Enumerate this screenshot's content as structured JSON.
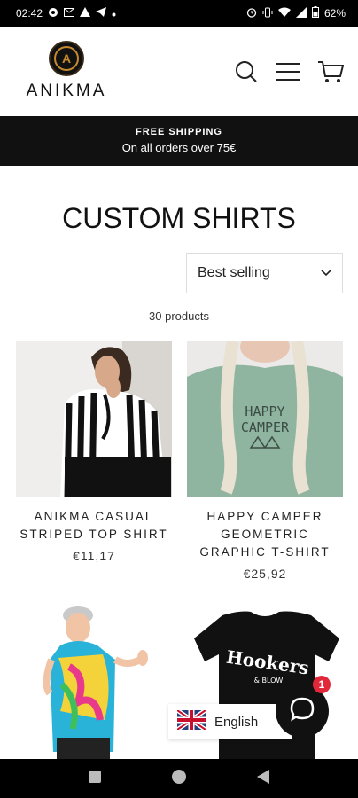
{
  "status": {
    "time": "02:42",
    "battery": "62%"
  },
  "header": {
    "logo_text": "ANIKMA",
    "logo_mark": "A"
  },
  "banner": {
    "title": "FREE SHIPPING",
    "subtitle": "On all orders over 75€"
  },
  "collection": {
    "title": "CUSTOM SHIRTS",
    "sort_value": "Best selling",
    "count": "30 products"
  },
  "products": [
    {
      "name": "ANIKMA CASUAL STRIPED TOP SHIRT",
      "price": "€11,17"
    },
    {
      "name": "HAPPY CAMPER GEOMETRIC GRAPHIC T-SHIRT",
      "price": "€25,92"
    },
    {
      "name": "",
      "price": ""
    },
    {
      "name": "",
      "price": ""
    }
  ],
  "graphic_text": {
    "camper_line1": "HAPPY",
    "camper_line2": "CAMPER",
    "hookers_line1": "Hookers",
    "hookers_line2": "& BLOW"
  },
  "language": {
    "label": "English"
  },
  "chat": {
    "badge_count": "1"
  },
  "colors": {
    "accent": "#c68a2e",
    "banner_bg": "#111111",
    "badge": "#e0283a"
  }
}
